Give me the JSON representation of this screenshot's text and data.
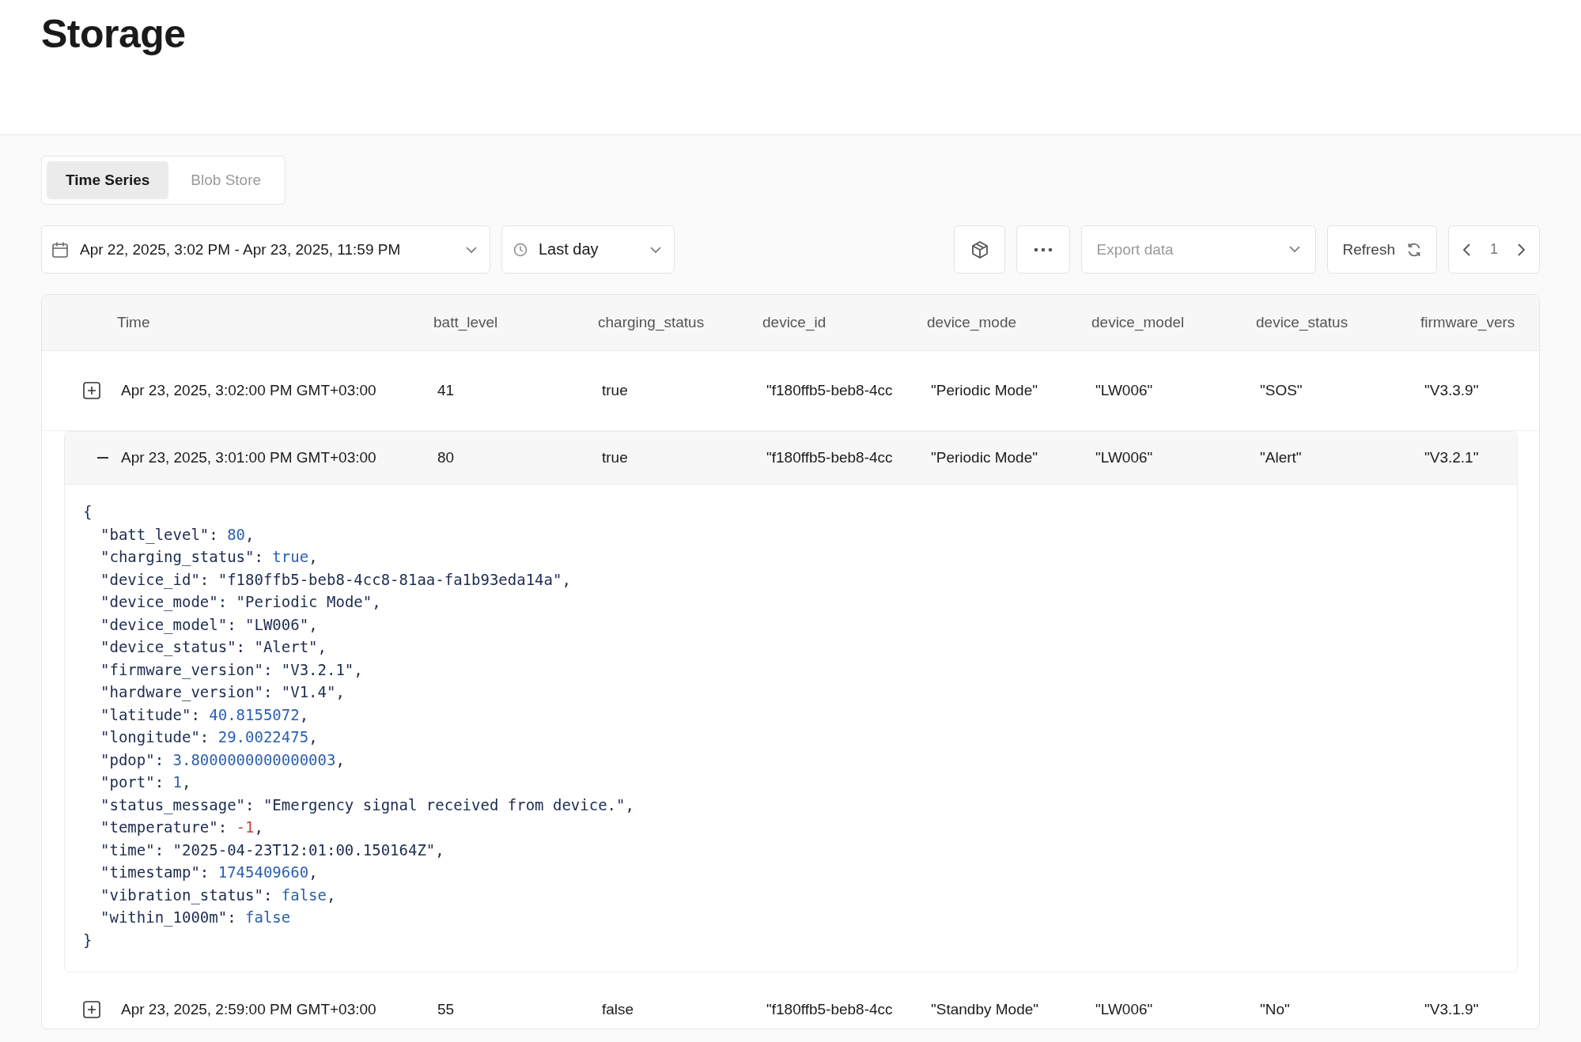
{
  "page": {
    "title": "Storage"
  },
  "tabs": [
    {
      "label": "Time Series",
      "selected": true
    },
    {
      "label": "Blob Store",
      "selected": false
    }
  ],
  "toolbar": {
    "date_range": "Apr 22, 2025, 3:02 PM - Apr 23, 2025, 11:59 PM",
    "period": "Last day",
    "export": {
      "placeholder": "Export data"
    },
    "refresh": "Refresh",
    "page": "1"
  },
  "table": {
    "columns": [
      "Time",
      "batt_level",
      "charging_status",
      "device_id",
      "device_mode",
      "device_model",
      "device_status",
      "firmware_vers"
    ],
    "rows": [
      {
        "expanded": false,
        "cells": [
          "Apr 23, 2025, 3:02:00 PM GMT+03:00",
          "41",
          "true",
          "\"f180ffb5-beb8-4cc",
          "\"Periodic Mode\"",
          "\"LW006\"",
          "\"SOS\"",
          "\"V3.3.9\""
        ]
      },
      {
        "expanded": true,
        "cells": [
          "Apr 23, 2025, 3:01:00 PM GMT+03:00",
          "80",
          "true",
          "\"f180ffb5-beb8-4cc",
          "\"Periodic Mode\"",
          "\"LW006\"",
          "\"Alert\"",
          "\"V3.2.1\""
        ],
        "details": {
          "open": "{",
          "close": "}",
          "entries": [
            {
              "key": "\"batt_level\":",
              "value": "80",
              "kind": "number",
              "end": ","
            },
            {
              "key": "\"charging_status\":",
              "value": "true",
              "kind": "boolean",
              "end": ","
            },
            {
              "key": "\"device_id\":",
              "value": "\"f180ffb5-beb8-4cc8-81aa-fa1b93eda14a\"",
              "kind": "string",
              "end": ","
            },
            {
              "key": "\"device_mode\":",
              "value": "\"Periodic Mode\"",
              "kind": "string",
              "end": ","
            },
            {
              "key": "\"device_model\":",
              "value": "\"LW006\"",
              "kind": "string",
              "end": ","
            },
            {
              "key": "\"device_status\":",
              "value": "\"Alert\"",
              "kind": "string",
              "end": ","
            },
            {
              "key": "\"firmware_version\":",
              "value": "\"V3.2.1\"",
              "kind": "string",
              "end": ","
            },
            {
              "key": "\"hardware_version\":",
              "value": "\"V1.4\"",
              "kind": "string",
              "end": ","
            },
            {
              "key": "\"latitude\":",
              "value": "40.8155072",
              "kind": "number",
              "end": ","
            },
            {
              "key": "\"longitude\":",
              "value": "29.0022475",
              "kind": "number",
              "end": ","
            },
            {
              "key": "\"pdop\":",
              "value": "3.8000000000000003",
              "kind": "number",
              "end": ","
            },
            {
              "key": "\"port\":",
              "value": "1",
              "kind": "number",
              "end": ","
            },
            {
              "key": "\"status_message\":",
              "value": "\"Emergency signal received from device.\"",
              "kind": "string",
              "end": ","
            },
            {
              "key": "\"temperature\":",
              "value": "-1",
              "kind": "negative",
              "end": ","
            },
            {
              "key": "\"time\":",
              "value": "\"2025-04-23T12:01:00.150164Z\"",
              "kind": "string",
              "end": ","
            },
            {
              "key": "\"timestamp\":",
              "value": "1745409660",
              "kind": "number",
              "end": ","
            },
            {
              "key": "\"vibration_status\":",
              "value": "false",
              "kind": "boolean",
              "end": ","
            },
            {
              "key": "\"within_1000m\":",
              "value": "false",
              "kind": "boolean"
            }
          ]
        }
      },
      {
        "expanded": false,
        "cells": [
          "Apr 23, 2025, 2:59:00 PM GMT+03:00",
          "55",
          "false",
          "\"f180ffb5-beb8-4cc",
          "\"Standby Mode\"",
          "\"LW006\"",
          "\"No\"",
          "\"V3.1.9\""
        ]
      }
    ]
  }
}
